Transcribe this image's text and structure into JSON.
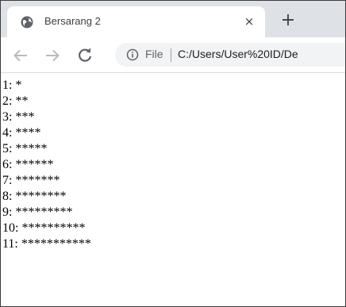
{
  "browser": {
    "tab": {
      "title": "Bersarang 2",
      "close_glyph": "×",
      "favicon_icon": "globe-icon"
    },
    "new_tab_glyph": "+",
    "toolbar": {
      "back_icon": "back-arrow-icon",
      "forward_icon": "forward-arrow-icon",
      "reload_icon": "reload-icon"
    },
    "omnibox": {
      "info_icon": "info-icon",
      "scheme_label": "File",
      "url": "C:/Users/User%20ID/De"
    }
  },
  "page": {
    "lines": [
      "1: *",
      "2: **",
      "3: ***",
      "4: ****",
      "5: *****",
      "6: ******",
      "7: *******",
      "8: ********",
      "9: *********",
      "10: **********",
      "11: ***********"
    ]
  }
}
